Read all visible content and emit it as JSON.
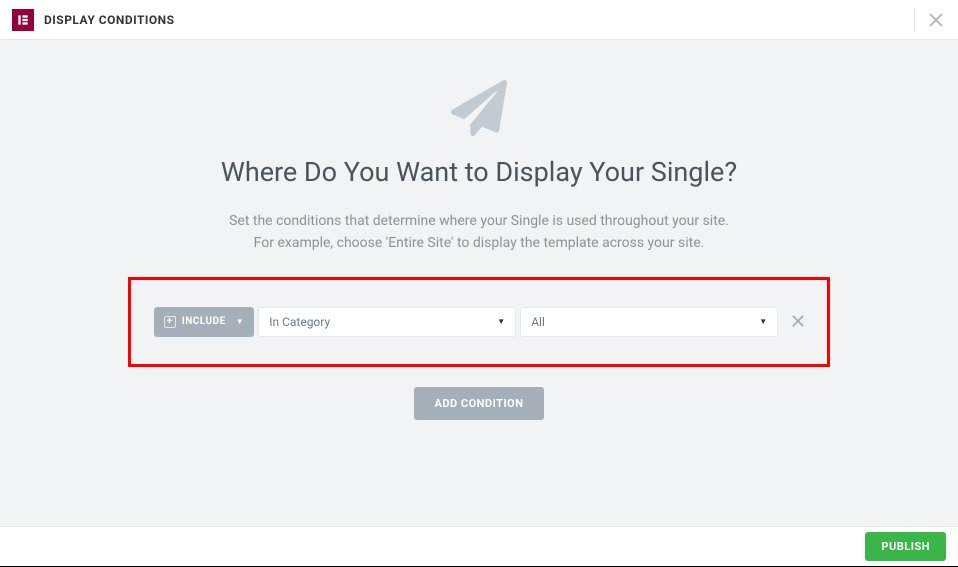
{
  "header": {
    "title": "DISPLAY CONDITIONS"
  },
  "main": {
    "title": "Where Do You Want to Display Your Single?",
    "desc_line1": "Set the conditions that determine where your Single is used throughout your site.",
    "desc_line2": "For example, choose 'Entire Site' to display the template across your site.",
    "include_label": "INCLUDE",
    "select1_value": "In Category",
    "select2_value": "All",
    "add_condition_label": "ADD CONDITION"
  },
  "footer": {
    "publish_label": "PUBLISH"
  }
}
